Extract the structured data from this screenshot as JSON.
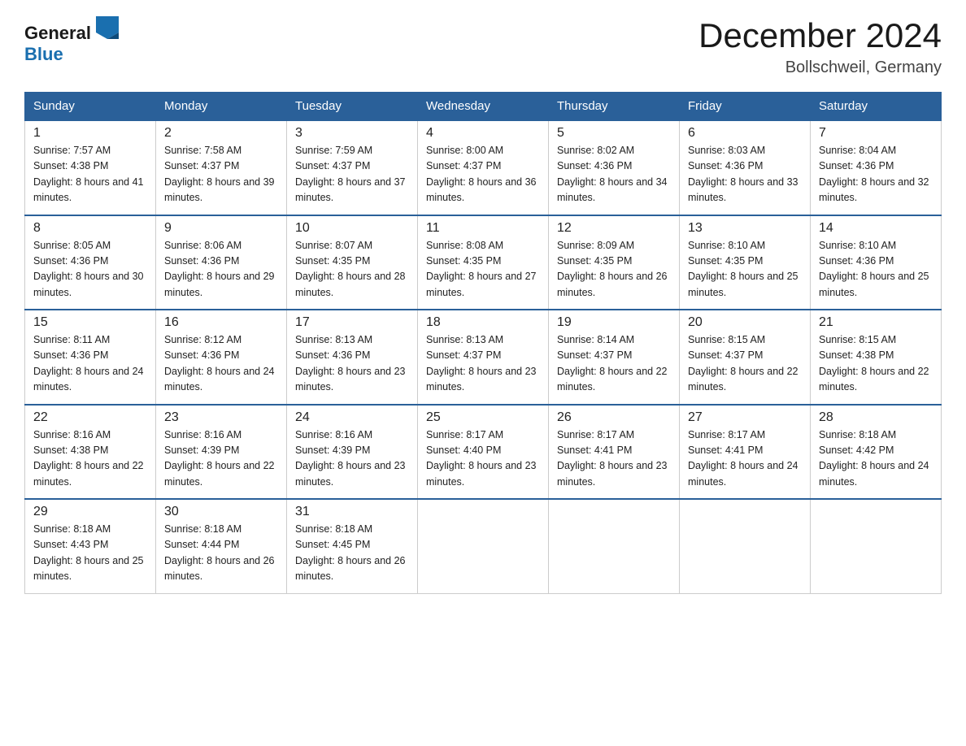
{
  "header": {
    "logo_general": "General",
    "logo_blue": "Blue",
    "title": "December 2024",
    "location": "Bollschweil, Germany"
  },
  "weekdays": [
    "Sunday",
    "Monday",
    "Tuesday",
    "Wednesday",
    "Thursday",
    "Friday",
    "Saturday"
  ],
  "weeks": [
    [
      {
        "day": "1",
        "sunrise": "7:57 AM",
        "sunset": "4:38 PM",
        "daylight": "8 hours and 41 minutes."
      },
      {
        "day": "2",
        "sunrise": "7:58 AM",
        "sunset": "4:37 PM",
        "daylight": "8 hours and 39 minutes."
      },
      {
        "day": "3",
        "sunrise": "7:59 AM",
        "sunset": "4:37 PM",
        "daylight": "8 hours and 37 minutes."
      },
      {
        "day": "4",
        "sunrise": "8:00 AM",
        "sunset": "4:37 PM",
        "daylight": "8 hours and 36 minutes."
      },
      {
        "day": "5",
        "sunrise": "8:02 AM",
        "sunset": "4:36 PM",
        "daylight": "8 hours and 34 minutes."
      },
      {
        "day": "6",
        "sunrise": "8:03 AM",
        "sunset": "4:36 PM",
        "daylight": "8 hours and 33 minutes."
      },
      {
        "day": "7",
        "sunrise": "8:04 AM",
        "sunset": "4:36 PM",
        "daylight": "8 hours and 32 minutes."
      }
    ],
    [
      {
        "day": "8",
        "sunrise": "8:05 AM",
        "sunset": "4:36 PM",
        "daylight": "8 hours and 30 minutes."
      },
      {
        "day": "9",
        "sunrise": "8:06 AM",
        "sunset": "4:36 PM",
        "daylight": "8 hours and 29 minutes."
      },
      {
        "day": "10",
        "sunrise": "8:07 AM",
        "sunset": "4:35 PM",
        "daylight": "8 hours and 28 minutes."
      },
      {
        "day": "11",
        "sunrise": "8:08 AM",
        "sunset": "4:35 PM",
        "daylight": "8 hours and 27 minutes."
      },
      {
        "day": "12",
        "sunrise": "8:09 AM",
        "sunset": "4:35 PM",
        "daylight": "8 hours and 26 minutes."
      },
      {
        "day": "13",
        "sunrise": "8:10 AM",
        "sunset": "4:35 PM",
        "daylight": "8 hours and 25 minutes."
      },
      {
        "day": "14",
        "sunrise": "8:10 AM",
        "sunset": "4:36 PM",
        "daylight": "8 hours and 25 minutes."
      }
    ],
    [
      {
        "day": "15",
        "sunrise": "8:11 AM",
        "sunset": "4:36 PM",
        "daylight": "8 hours and 24 minutes."
      },
      {
        "day": "16",
        "sunrise": "8:12 AM",
        "sunset": "4:36 PM",
        "daylight": "8 hours and 24 minutes."
      },
      {
        "day": "17",
        "sunrise": "8:13 AM",
        "sunset": "4:36 PM",
        "daylight": "8 hours and 23 minutes."
      },
      {
        "day": "18",
        "sunrise": "8:13 AM",
        "sunset": "4:37 PM",
        "daylight": "8 hours and 23 minutes."
      },
      {
        "day": "19",
        "sunrise": "8:14 AM",
        "sunset": "4:37 PM",
        "daylight": "8 hours and 22 minutes."
      },
      {
        "day": "20",
        "sunrise": "8:15 AM",
        "sunset": "4:37 PM",
        "daylight": "8 hours and 22 minutes."
      },
      {
        "day": "21",
        "sunrise": "8:15 AM",
        "sunset": "4:38 PM",
        "daylight": "8 hours and 22 minutes."
      }
    ],
    [
      {
        "day": "22",
        "sunrise": "8:16 AM",
        "sunset": "4:38 PM",
        "daylight": "8 hours and 22 minutes."
      },
      {
        "day": "23",
        "sunrise": "8:16 AM",
        "sunset": "4:39 PM",
        "daylight": "8 hours and 22 minutes."
      },
      {
        "day": "24",
        "sunrise": "8:16 AM",
        "sunset": "4:39 PM",
        "daylight": "8 hours and 23 minutes."
      },
      {
        "day": "25",
        "sunrise": "8:17 AM",
        "sunset": "4:40 PM",
        "daylight": "8 hours and 23 minutes."
      },
      {
        "day": "26",
        "sunrise": "8:17 AM",
        "sunset": "4:41 PM",
        "daylight": "8 hours and 23 minutes."
      },
      {
        "day": "27",
        "sunrise": "8:17 AM",
        "sunset": "4:41 PM",
        "daylight": "8 hours and 24 minutes."
      },
      {
        "day": "28",
        "sunrise": "8:18 AM",
        "sunset": "4:42 PM",
        "daylight": "8 hours and 24 minutes."
      }
    ],
    [
      {
        "day": "29",
        "sunrise": "8:18 AM",
        "sunset": "4:43 PM",
        "daylight": "8 hours and 25 minutes."
      },
      {
        "day": "30",
        "sunrise": "8:18 AM",
        "sunset": "4:44 PM",
        "daylight": "8 hours and 26 minutes."
      },
      {
        "day": "31",
        "sunrise": "8:18 AM",
        "sunset": "4:45 PM",
        "daylight": "8 hours and 26 minutes."
      },
      null,
      null,
      null,
      null
    ]
  ]
}
